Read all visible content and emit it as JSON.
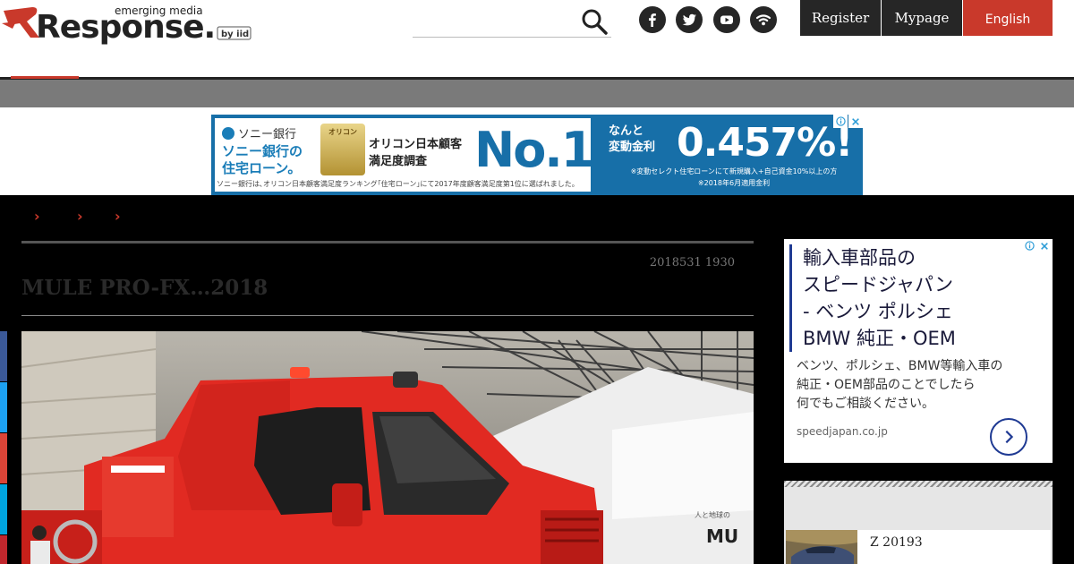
{
  "header": {
    "logo_text": "Response.",
    "logo_tagline": "emerging media",
    "logo_badge": "by iid",
    "search": {
      "placeholder": ""
    },
    "social_links": [
      {
        "name": "facebook",
        "icon": "facebook-icon"
      },
      {
        "name": "twitter",
        "icon": "twitter-icon"
      },
      {
        "name": "youtube",
        "icon": "youtube-icon"
      },
      {
        "name": "rss",
        "icon": "rss-icon"
      }
    ],
    "auth": {
      "register_label": "Register",
      "mypage_label": "Mypage",
      "language_label": "English"
    }
  },
  "banner_ad": {
    "bank_name": "ソニー銀行",
    "loan_line1": "ソニー銀行の",
    "loan_line2": "住宅ローン。",
    "medal_label": "オリコン",
    "oricon_line1": "オリコン日本顧客",
    "oricon_line2": "満足度調査",
    "headline": "No.1",
    "footnote": "ソニー銀行は､オリコン日本顧客満足度ランキング｢住宅ローン｣にて2017年度顧客満足度第1位に選ばれました。",
    "rate_label_line1": "なんと",
    "rate_label_line2": "変動金利",
    "rate_value": "0.457%!",
    "rate_note1": "※変動セレクト住宅ローンにて新規購入+自己資金10%以上の方",
    "rate_note2": "※2018年6月適用金利"
  },
  "article": {
    "date": "2018531 1930",
    "title": "MULE PRO-FX…2018",
    "hero_sign": "人と地球の",
    "hero_brand": "MU"
  },
  "side_ad": {
    "headline_lines": [
      "輸入車部品の",
      "スピードジャパン",
      "- ベンツ ポルシェ",
      "BMW 純正・OEM"
    ],
    "body_lines": [
      "ベンツ、ポルシェ、BMW等輸入車の",
      "純正・OEM部品のことでしたら",
      "何でもご相談ください。"
    ],
    "domain": "speedjapan.co.jp"
  },
  "ranking": {
    "items": [
      {
        "title": "Z 20193"
      }
    ]
  },
  "colors": {
    "accent": "#c9392b",
    "header_dark": "#262626",
    "banner_blue": "#176fa8",
    "ad_navy": "#1f3a93",
    "share_facebook": "#3b5998",
    "share_twitter": "#1da1f2",
    "share_google": "#db4437",
    "share_hatena": "#00a4de",
    "share_line": "#c1272d"
  }
}
